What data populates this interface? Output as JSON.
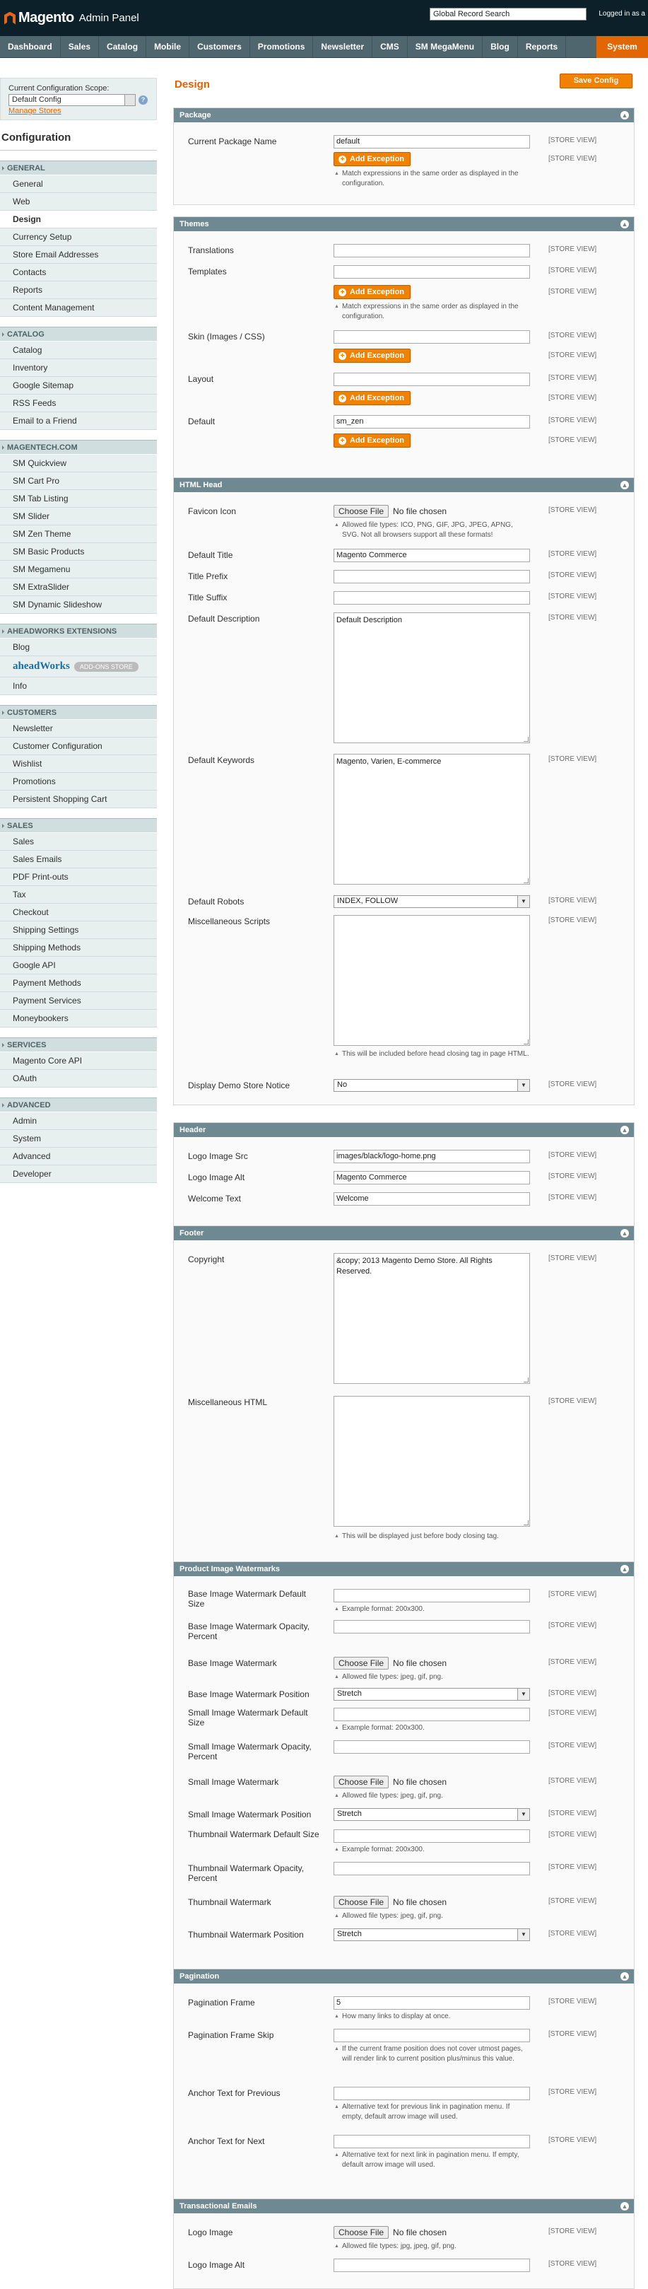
{
  "header": {
    "brand": "Magento",
    "subtitle": "Admin Panel",
    "search": "Global Record Search",
    "logged_in": "Logged in as a"
  },
  "nav": {
    "items": [
      "Dashboard",
      "Sales",
      "Catalog",
      "Mobile",
      "Customers",
      "Promotions",
      "Newsletter",
      "CMS",
      "SM MegaMenu",
      "Blog",
      "Reports"
    ],
    "active": "System"
  },
  "side": {
    "scope_label": "Current Configuration Scope:",
    "scope_value": "Default Config",
    "manage_stores": "Manage Stores",
    "config_title": "Configuration",
    "sections": [
      {
        "title": "GENERAL",
        "items": [
          "General",
          "Web",
          "Design",
          "Currency Setup",
          "Store Email Addresses",
          "Contacts",
          "Reports",
          "Content Management"
        ]
      },
      {
        "title": "CATALOG",
        "items": [
          "Catalog",
          "Inventory",
          "Google Sitemap",
          "RSS Feeds",
          "Email to a Friend"
        ]
      },
      {
        "title": "MAGENTECH.COM",
        "items": [
          "SM Quickview",
          "SM Cart Pro",
          "SM Tab Listing",
          "SM Slider",
          "SM Zen Theme",
          "SM Basic Products",
          "SM Megamenu",
          "SM ExtraSlider",
          "SM Dynamic Slideshow"
        ]
      },
      {
        "title": "AHEADWORKS EXTENSIONS",
        "items": [
          "Blog",
          "Info"
        ]
      },
      {
        "title": "CUSTOMERS",
        "items": [
          "Newsletter",
          "Customer Configuration",
          "Wishlist",
          "Promotions",
          "Persistent Shopping Cart"
        ]
      },
      {
        "title": "SALES",
        "items": [
          "Sales",
          "Sales Emails",
          "PDF Print-outs",
          "Tax",
          "Checkout",
          "Shipping Settings",
          "Shipping Methods",
          "Google API",
          "Payment Methods",
          "Payment Services",
          "Moneybookers"
        ]
      },
      {
        "title": "SERVICES",
        "items": [
          "Magento Core API",
          "OAuth"
        ]
      },
      {
        "title": "ADVANCED",
        "items": [
          "Admin",
          "System",
          "Advanced",
          "Developer"
        ]
      }
    ],
    "aw_logo": "aheadWorks",
    "aw_badge": "ADD-ONS STORE"
  },
  "main": {
    "title": "Design",
    "save": "Save Config",
    "scope_text": "[STORE VIEW]",
    "add_exception": "Add Exception",
    "choose_file": "Choose File",
    "no_file": "No file chosen",
    "match_note": "Match expressions in the same order as displayed in the configuration.",
    "package": {
      "title": "Package",
      "name_label": "Current Package Name",
      "name_value": "default"
    },
    "themes": {
      "title": "Themes",
      "translations": "Translations",
      "templates": "Templates",
      "skin": "Skin (Images / CSS)",
      "layout": "Layout",
      "default": "Default",
      "default_value": "sm_zen"
    },
    "html_head": {
      "title": "HTML Head",
      "favicon": "Favicon Icon",
      "favicon_note": "Allowed file types: ICO, PNG, GIF, JPG, JPEG, APNG, SVG. Not all browsers support all these formats!",
      "default_title": "Default Title",
      "default_title_value": "Magento Commerce",
      "title_prefix": "Title Prefix",
      "title_suffix": "Title Suffix",
      "default_desc": "Default Description",
      "default_desc_value": "Default Description",
      "default_kw": "Default Keywords",
      "default_kw_value": "Magento, Varien, E-commerce",
      "robots": "Default Robots",
      "robots_value": "INDEX, FOLLOW",
      "misc": "Miscellaneous Scripts",
      "misc_note": "This will be included before head closing tag in page HTML.",
      "demo": "Display Demo Store Notice",
      "demo_value": "No"
    },
    "header_fs": {
      "title": "Header",
      "logo_src": "Logo Image Src",
      "logo_src_value": "images/black/logo-home.png",
      "logo_alt": "Logo Image Alt",
      "logo_alt_value": "Magento Commerce",
      "welcome": "Welcome Text",
      "welcome_value": "Welcome"
    },
    "footer": {
      "title": "Footer",
      "copyright": "Copyright",
      "copyright_value": "&copy; 2013 Magento Demo Store. All Rights Reserved.",
      "misc_html": "Miscellaneous HTML",
      "misc_note": "This will be displayed just before body closing tag."
    },
    "watermarks": {
      "title": "Product Image Watermarks",
      "example": "Example format: 200x300.",
      "file_note": "Allowed file types: jpeg, gif, png.",
      "stretch": "Stretch",
      "base_size": "Base Image Watermark Default Size",
      "base_op": "Base Image Watermark Opacity, Percent",
      "base_wm": "Base Image Watermark",
      "base_pos": "Base Image Watermark Position",
      "small_size": "Small Image Watermark Default Size",
      "small_op": "Small Image Watermark Opacity, Percent",
      "small_wm": "Small Image Watermark",
      "small_pos": "Small Image Watermark Position",
      "thumb_size": "Thumbnail Watermark Default Size",
      "thumb_op": "Thumbnail Watermark Opacity, Percent",
      "thumb_wm": "Thumbnail Watermark",
      "thumb_pos": "Thumbnail Watermark Position"
    },
    "pagination": {
      "title": "Pagination",
      "frame": "Pagination Frame",
      "frame_value": "5",
      "frame_note": "How many links to display at once.",
      "skip": "Pagination Frame Skip",
      "skip_note": "If the current frame position does not cover utmost pages, will render link to current position plus/minus this value.",
      "prev": "Anchor Text for Previous",
      "prev_note": "Alternative text for previous link in pagination menu. If empty, default arrow image will used.",
      "next": "Anchor Text for Next",
      "next_note": "Alternative text for next link in pagination menu. If empty, default arrow image will used."
    },
    "emails": {
      "title": "Transactional Emails",
      "logo": "Logo Image",
      "logo_note": "Allowed file types: jpg, jpeg, gif, png.",
      "logo_alt": "Logo Image Alt"
    }
  }
}
